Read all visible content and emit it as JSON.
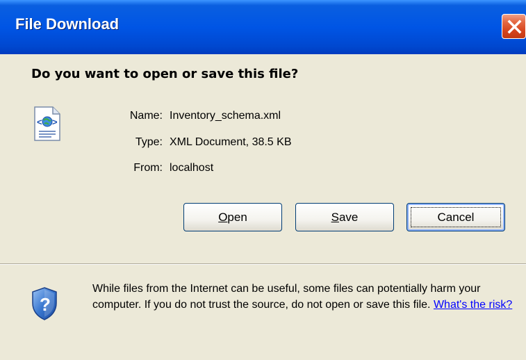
{
  "window": {
    "title": "File Download"
  },
  "dialog": {
    "question": "Do you want to open or save this file?",
    "file": {
      "name_label": "Name:",
      "name_value": "Inventory_schema.xml",
      "type_label": "Type:",
      "type_value": "XML Document, 38.5 KB",
      "from_label": "From:",
      "from_value": "localhost",
      "icon": "xml-document-icon"
    },
    "buttons": {
      "open_mnemonic": "O",
      "open_rest": "pen",
      "save_mnemonic": "S",
      "save_rest": "ave",
      "cancel": "Cancel"
    },
    "warning": {
      "text": "While files from the Internet can be useful, some files can potentially harm your computer. If you do not trust the source, do not open or save this file.",
      "link": "What's the risk?",
      "icon": "security-shield-icon"
    }
  },
  "colors": {
    "titlebar": "#0055e5",
    "dialog_bg": "#ece9d8",
    "close_button": "#d5431c",
    "link": "#0000ff"
  }
}
